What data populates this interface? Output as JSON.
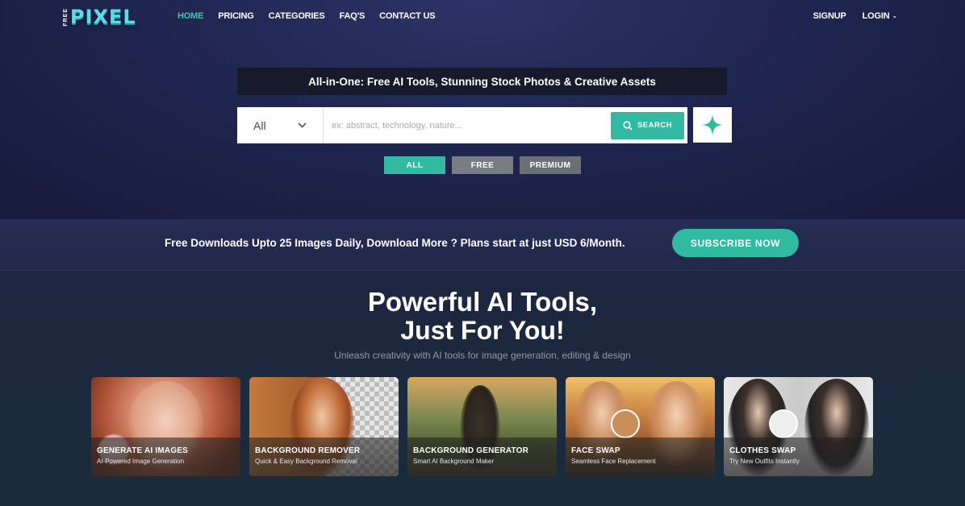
{
  "nav": {
    "logo_small": "FREE",
    "logo_main": "PIXEL",
    "links": [
      {
        "label": "HOME",
        "active": true
      },
      {
        "label": "PRICING"
      },
      {
        "label": "CATEGORIES"
      },
      {
        "label": "FAQ'S"
      },
      {
        "label": "CONTACT US"
      }
    ],
    "signup": "SIGNUP",
    "login": "LOGIN"
  },
  "hero": {
    "tagline": "All-in-One: Free AI Tools, Stunning Stock Photos & Creative Assets",
    "search": {
      "category": "All",
      "placeholder": "ex: abstract, technology, nature...",
      "button": "SEARCH"
    },
    "filters": [
      "ALL",
      "FREE",
      "PREMIUM"
    ]
  },
  "promo": {
    "text": "Free Downloads Upto 25 Images Daily, Download More ? Plans start at just USD 6/Month.",
    "button": "SUBSCRIBE NOW"
  },
  "tools": {
    "heading_line1": "Powerful AI Tools,",
    "heading_line2": "Just For You!",
    "subheading": "Unleash creativity with AI tools for image generation, editing & design",
    "cards": [
      {
        "title": "GENERATE AI IMAGES",
        "subtitle": "AI-Powered Image Generation"
      },
      {
        "title": "BACKGROUND REMOVER",
        "subtitle": "Quick & Easy Background Removal"
      },
      {
        "title": "BACKGROUND GENERATOR",
        "subtitle": "Smart AI Background Maker"
      },
      {
        "title": "FACE SWAP",
        "subtitle": "Seamless Face Replacement"
      },
      {
        "title": "CLOTHES SWAP",
        "subtitle": "Try New Outfits Instantly"
      }
    ]
  },
  "colors": {
    "accent": "#31b9a1",
    "nav_active": "#3ec7b0",
    "background": "#1f2448"
  }
}
